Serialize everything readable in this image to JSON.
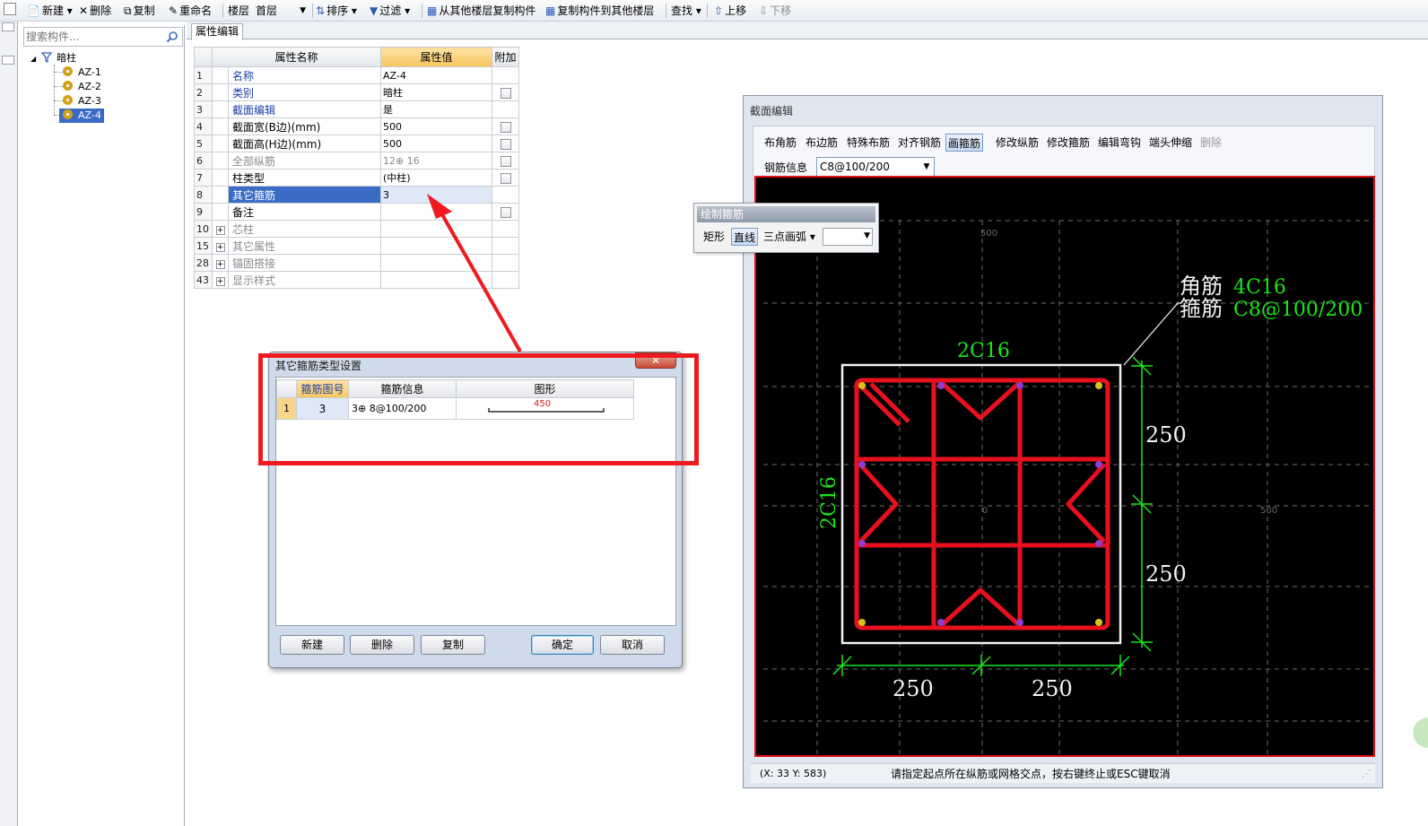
{
  "toolbar": {
    "new": "新建",
    "delete": "删除",
    "copy": "复制",
    "rename": "重命名",
    "floor_label": "楼层",
    "floor_value": "首层",
    "sort": "排序",
    "filter": "过滤",
    "copy_from_other_floor": "从其他楼层复制构件",
    "copy_to_other_floor": "复制构件到其他楼层",
    "find": "查找",
    "move_up": "上移",
    "move_down": "下移"
  },
  "search": {
    "placeholder": "搜索构件..."
  },
  "tree": {
    "root": "暗柱",
    "items": [
      "AZ-1",
      "AZ-2",
      "AZ-3",
      "AZ-4"
    ],
    "selected": "AZ-4"
  },
  "tab": {
    "label": "属性编辑"
  },
  "prop_grid": {
    "headers": {
      "name": "属性名称",
      "value": "属性值",
      "extra": "附加"
    },
    "rows": [
      {
        "num": "1",
        "name": "名称",
        "value": "AZ-4"
      },
      {
        "num": "2",
        "name": "类别",
        "value": "暗柱"
      },
      {
        "num": "3",
        "name": "截面编辑",
        "value": "是"
      },
      {
        "num": "4",
        "name": "截面宽(B边)(mm)",
        "value": "500"
      },
      {
        "num": "5",
        "name": "截面高(H边)(mm)",
        "value": "500"
      },
      {
        "num": "6",
        "name": "全部纵筋",
        "value": "12⊕ 16"
      },
      {
        "num": "7",
        "name": "柱类型",
        "value": "(中柱)"
      },
      {
        "num": "8",
        "name": "其它箍筋",
        "value": "3"
      },
      {
        "num": "9",
        "name": "备注",
        "value": ""
      },
      {
        "num": "10",
        "name": "芯柱",
        "value": ""
      },
      {
        "num": "15",
        "name": "其它属性",
        "value": ""
      },
      {
        "num": "28",
        "name": "锚固搭接",
        "value": ""
      },
      {
        "num": "43",
        "name": "显示样式",
        "value": ""
      }
    ]
  },
  "section_editor": {
    "title": "截面编辑",
    "tools": [
      "布角筋",
      "布边筋",
      "特殊布筋",
      "对齐钢筋",
      "画箍筋",
      "修改纵筋",
      "修改箍筋",
      "编辑弯钩",
      "端头伸缩",
      "删除"
    ],
    "active_tool": "画箍筋",
    "rebar_info_label": "钢筋信息",
    "rebar_info_value": "C8@100/200",
    "status_coords": "(X: 33 Y: 583)",
    "status_hint": "请指定起点所在纵筋或网格交点，按右键终止或ESC键取消",
    "canvas": {
      "grid_top_label": "500",
      "grid_center_label": "0",
      "grid_right_label": "500",
      "corner_label": "角筋",
      "corner_value": "4C16",
      "stirrup_label": "箍筋",
      "stirrup_value": "C8@100/200",
      "top_edge_rebar": "2C16",
      "left_edge_rebar": "2C16",
      "dims": [
        "250",
        "250",
        "250",
        "250"
      ]
    }
  },
  "draw_panel": {
    "title": "绘制箍筋",
    "options": [
      "矩形",
      "直线",
      "三点画弧"
    ],
    "active": "直线"
  },
  "dialog": {
    "title": "其它箍筋类型设置",
    "headers": {
      "code": "箍筋图号",
      "info": "箍筋信息",
      "shape": "图形"
    },
    "row": {
      "num": "1",
      "code": "3",
      "info": "3⊕ 8@100/200",
      "shape_value": "450"
    },
    "buttons": {
      "new": "新建",
      "delete": "删除",
      "copy": "复制",
      "ok": "确定",
      "cancel": "取消"
    }
  },
  "colors": {
    "accent_selection": "#3a6cc6",
    "highlight_red": "#ef1a20",
    "rebar_red": "#e8101e",
    "dim_green": "#19e619"
  }
}
